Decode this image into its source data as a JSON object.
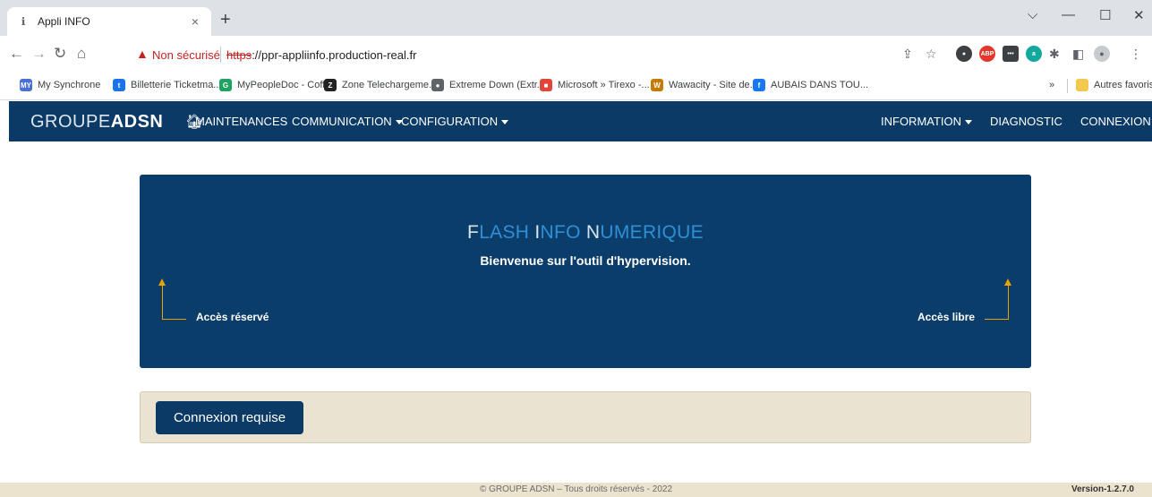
{
  "browser": {
    "tab_title": "Appli INFO",
    "tab_close": "×",
    "new_tab": "+",
    "security_label": "Non sécurisé",
    "url_scheme": "https",
    "url_rest": "://ppr-appliinfo.production-real.fr",
    "bookmarks": [
      {
        "label": "My Synchrone",
        "icon": "MY",
        "color": "#4a6fd6"
      },
      {
        "label": "Billetterie Ticketma...",
        "icon": "t",
        "color": "#1a73e8"
      },
      {
        "label": "MyPeopleDoc - Coff...",
        "icon": "G",
        "color": "#1ea362"
      },
      {
        "label": "Zone Telechargeme...",
        "icon": "Z",
        "color": "#222222"
      },
      {
        "label": "Extreme Down (Extr...",
        "icon": "●",
        "color": "#5f6368"
      },
      {
        "label": "Microsoft » Tirexo -...",
        "icon": "■",
        "color": "#e0453a"
      },
      {
        "label": "Wawacity - Site de...",
        "icon": "W",
        "color": "#c77a00"
      },
      {
        "label": "AUBAIS DANS TOU...",
        "icon": "f",
        "color": "#1877f2"
      }
    ],
    "bookmarks_more": "»",
    "other_bookmarks": "Autres favoris"
  },
  "navbar": {
    "brand_light": "GROUPE",
    "brand_bold": "ADSN",
    "links": {
      "maintenances": "MAINTENANCES",
      "communication": "COMMUNICATION",
      "configuration": "CONFIGURATION",
      "information": "INFORMATION",
      "diagnostic": "DIAGNOSTIC",
      "connexion": "CONNEXION"
    }
  },
  "hero": {
    "title_parts": {
      "f": "F",
      "lash": "LASH ",
      "i": "I",
      "nfo": "NFO ",
      "n": "N",
      "umerique": "UMERIQUE"
    },
    "subtitle": "Bienvenue sur l'outil d'hypervision.",
    "access_reserved": "Accès réservé",
    "access_free": "Accès libre"
  },
  "login": {
    "button_label": "Connexion requise"
  },
  "footer": {
    "copyright": "© GROUPE ADSN – Tous droits réservés - 2022",
    "version": "Version-1.2.7.0"
  },
  "colors": {
    "navbar": "#0b3a66",
    "hero": "#0b3d6b",
    "accent_arrow": "#e8a200",
    "login_box": "#ebe3d1"
  }
}
